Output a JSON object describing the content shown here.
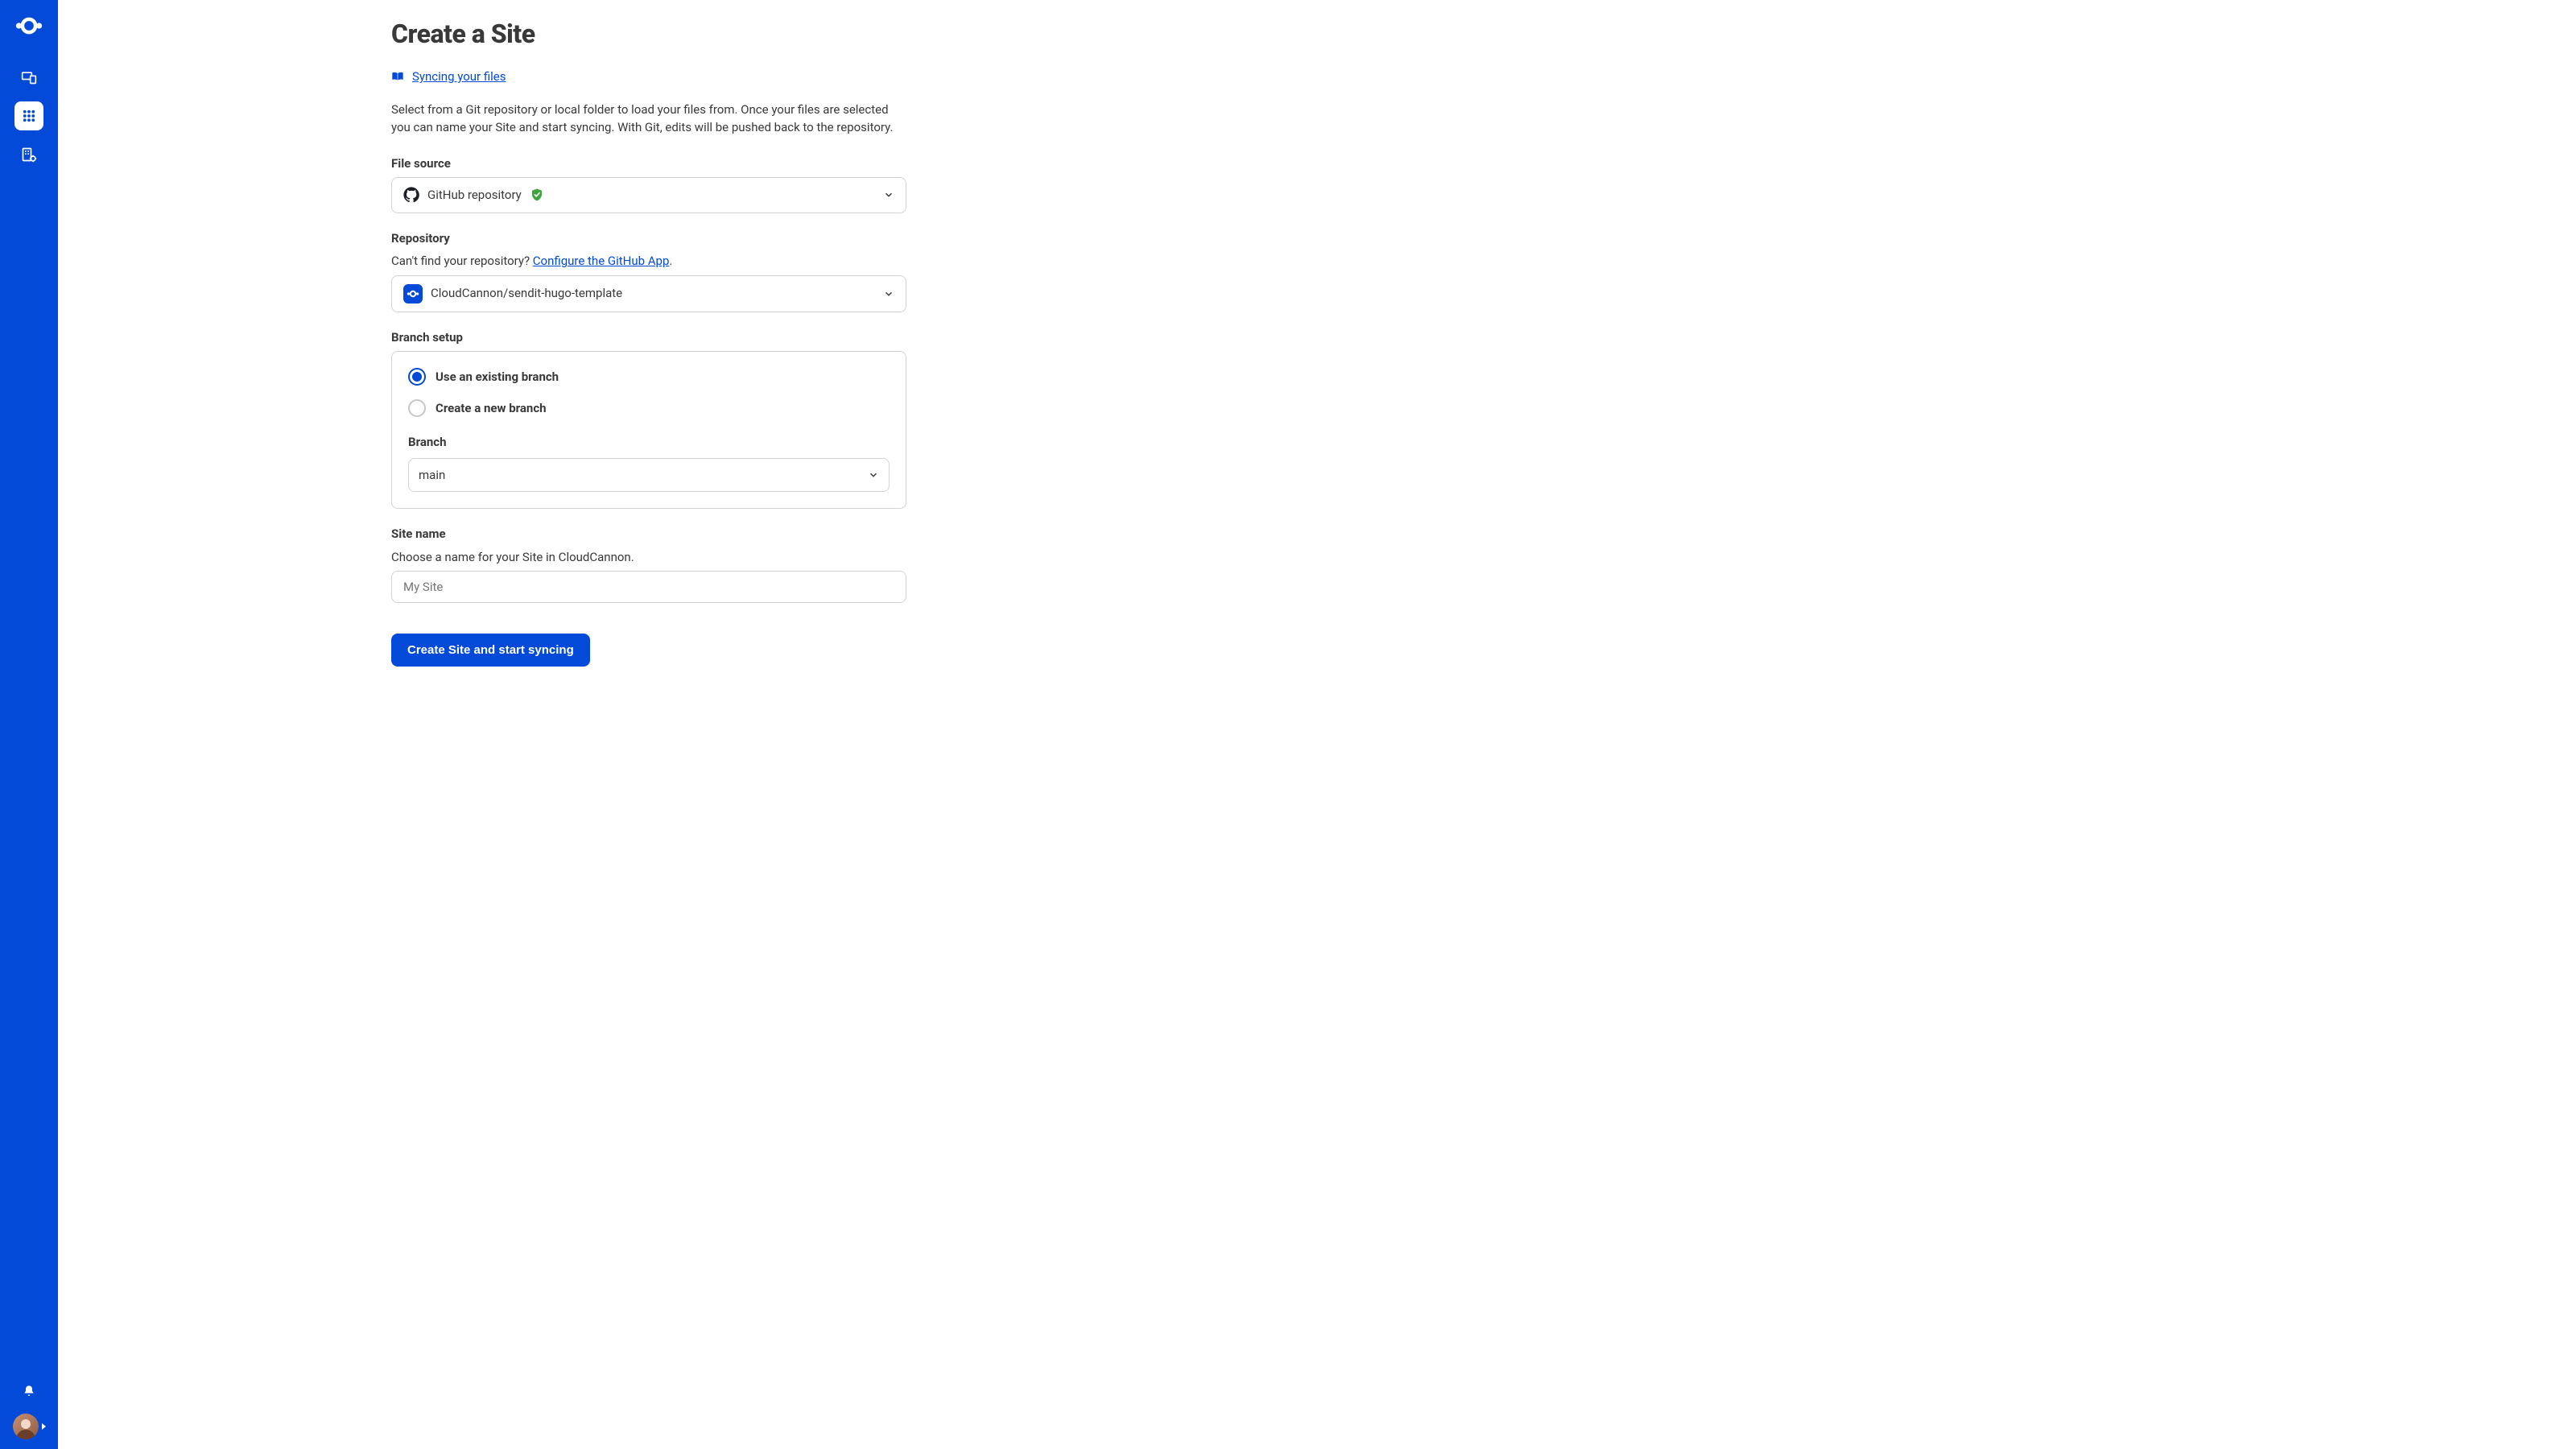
{
  "page": {
    "title": "Create a Site",
    "doc_link": "Syncing your files",
    "intro": "Select from a Git repository or local folder to load your files from. Once your files are selected you can name your Site and start syncing. With Git, edits will be pushed back to the repository."
  },
  "file_source": {
    "label": "File source",
    "selected": "GitHub repository"
  },
  "repository": {
    "label": "Repository",
    "help_prefix": "Can't find your repository? ",
    "help_link": "Configure the GitHub App",
    "help_suffix": ".",
    "selected": "CloudCannon/sendit-hugo-template"
  },
  "branch_setup": {
    "label": "Branch setup",
    "option_existing": "Use an existing branch",
    "option_new": "Create a new branch",
    "branch_label": "Branch",
    "selected_branch": "main"
  },
  "site_name": {
    "label": "Site name",
    "help": "Choose a name for your Site in CloudCannon.",
    "placeholder": "My Site"
  },
  "actions": {
    "submit": "Create Site and start syncing"
  }
}
